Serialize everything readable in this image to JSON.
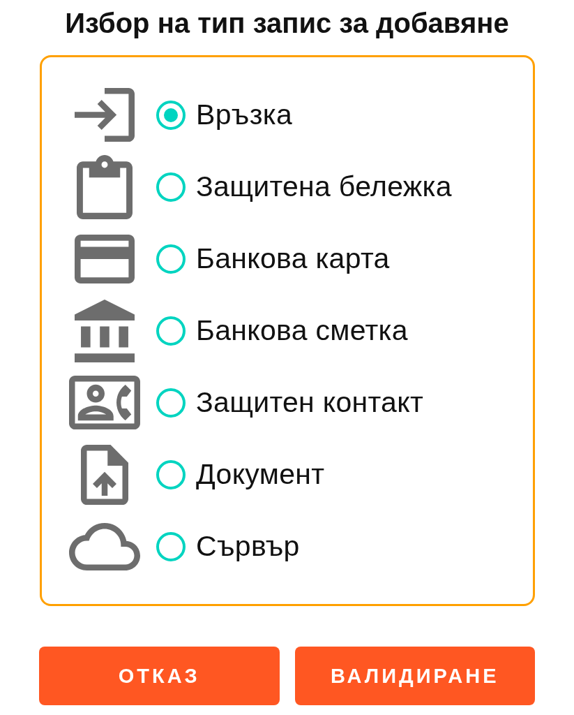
{
  "title": "Избор на тип запис за добавяне",
  "options": [
    {
      "label": "Връзка",
      "selected": true
    },
    {
      "label": "Защитена бележка",
      "selected": false
    },
    {
      "label": "Банкова карта",
      "selected": false
    },
    {
      "label": "Банкова сметка",
      "selected": false
    },
    {
      "label": "Защитен контакт",
      "selected": false
    },
    {
      "label": "Документ",
      "selected": false
    },
    {
      "label": "Сървър",
      "selected": false
    }
  ],
  "buttons": [
    {
      "label": "ОТКАЗ"
    },
    {
      "label": "ВАЛИДИРАНЕ"
    }
  ]
}
